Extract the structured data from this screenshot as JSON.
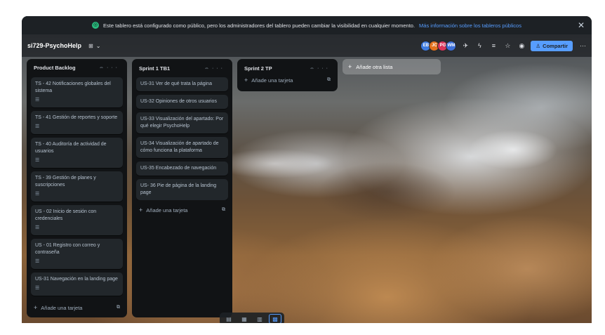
{
  "banner": {
    "text": "Este tablero está configurado como público, pero los administradores del tablero pueden cambiar la visibilidad en cualquier momento.",
    "link": "Más información sobre los tableros públicos",
    "close_icon": "close-icon"
  },
  "header": {
    "board_name": "si729-PsychoHelp",
    "visibility_icon": "board-visibility-icon",
    "avatars": [
      {
        "initials": "EB",
        "color": "#3d7be0"
      },
      {
        "initials": "JC",
        "color": "#e2711d"
      },
      {
        "initials": "PG",
        "color": "#d9345a"
      },
      {
        "initials": "WM",
        "color": "#3c6fd8"
      }
    ],
    "share_label": "Compartir",
    "icons": [
      "rocket-icon",
      "bolt-icon",
      "filter-icon",
      "star-icon",
      "visibility-icon"
    ]
  },
  "lists": [
    {
      "title": "Product Backlog",
      "cards": [
        {
          "text": "TS - 42 Notificaciones globales del sistema",
          "has_desc": true
        },
        {
          "text": "TS - 41 Gestión de reportes y soporte",
          "has_desc": true
        },
        {
          "text": "TS - 40 Auditoría de actividad de usuarios",
          "has_desc": true
        },
        {
          "text": "TS - 39 Gestión de planes y suscripciones",
          "has_desc": true
        },
        {
          "text": "US - 02 Inicio de sesión con credenciales",
          "has_desc": true
        },
        {
          "text": "US - 01 Registro con correo y contraseña",
          "has_desc": true
        },
        {
          "text": "US-31 Navegación en la landing page",
          "has_desc": true
        }
      ],
      "add_label": "Añade una tarjeta"
    },
    {
      "title": "Sprint 1 TB1",
      "cards": [
        {
          "text": "US-31 Ver de qué trata la página",
          "has_desc": false
        },
        {
          "text": "US-32 Opiniones de otros usuarios",
          "has_desc": false
        },
        {
          "text": "US-33 Visualización del apartado: Por qué elegir PsychoHelp",
          "has_desc": false
        },
        {
          "text": "US-34 Visualización de apartado de cómo funciona la plataforma",
          "has_desc": false
        },
        {
          "text": "US-35 Encabezado de navegación",
          "has_desc": false
        },
        {
          "text": "US- 36 Pie de página de la landing page",
          "has_desc": false
        }
      ],
      "add_label": "Añade una tarjeta"
    },
    {
      "title": "Sprint 2 TP",
      "cards": [],
      "add_label": "Añade una tarjeta"
    }
  ],
  "add_list_label": "Añade otra lista",
  "bottom_bar": [
    "inbox-icon",
    "planner-icon",
    "board-icon",
    "switch-boards-icon"
  ]
}
